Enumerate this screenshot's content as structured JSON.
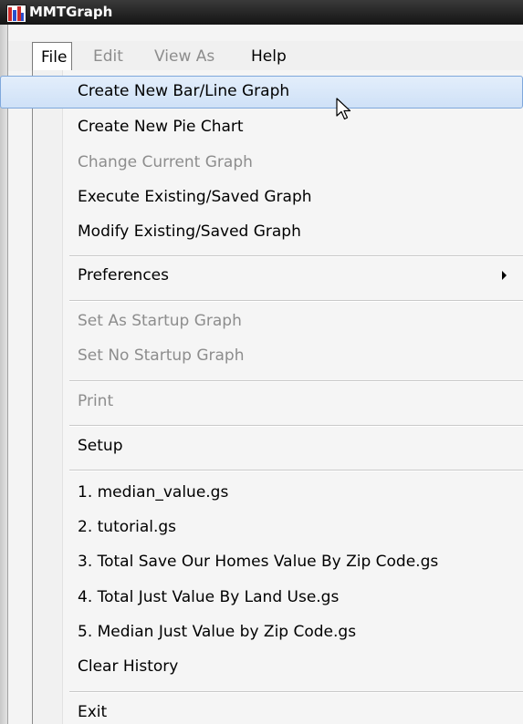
{
  "window": {
    "title": "MMTGraph"
  },
  "menubar": {
    "file": "File",
    "edit": "Edit",
    "view_as": "View As",
    "help": "Help"
  },
  "file_menu": {
    "create_bar_line": "Create New Bar/Line Graph",
    "create_pie": "Create New Pie Chart",
    "change_current": "Change Current Graph",
    "execute_saved": "Execute Existing/Saved Graph",
    "modify_saved": "Modify Existing/Saved Graph",
    "preferences": "Preferences",
    "set_startup": "Set As Startup Graph",
    "set_no_startup": "Set No Startup Graph",
    "print": "Print",
    "setup": "Setup",
    "recent": [
      "1. median_value.gs",
      "2. tutorial.gs",
      "3. Total Save Our Homes Value By Zip Code.gs",
      "4. Total Just Value By Land Use.gs",
      "5. Median Just Value by Zip Code.gs"
    ],
    "clear_history": "Clear History",
    "exit": "Exit"
  },
  "icons": {
    "app": "bar-chart-app-icon",
    "submenu": "triangle-right-icon",
    "cursor": "mouse-pointer-icon"
  },
  "colors": {
    "titlebar": "#1e1e1e",
    "highlight": "#cfe1f7",
    "highlight_border": "#7fa8dc",
    "disabled_text": "#8d8d8d"
  }
}
